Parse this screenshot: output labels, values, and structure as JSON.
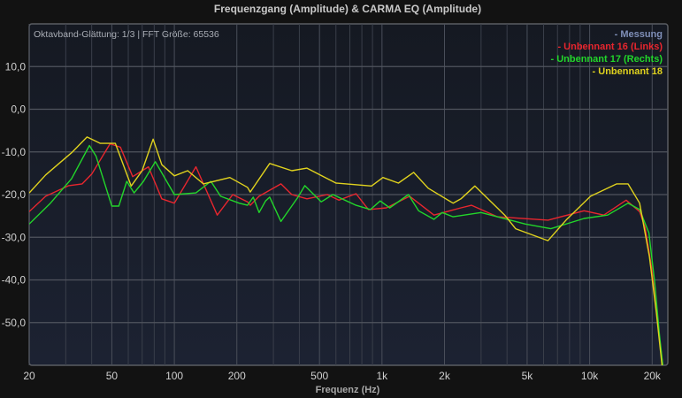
{
  "chart_data": {
    "type": "line",
    "title": "Frequenzgang (Amplitude) & CARMA EQ (Amplitude)",
    "xlabel": "Frequenz (Hz)",
    "ylabel": "",
    "xscale": "log",
    "xlim": [
      20,
      23800
    ],
    "ylim": [
      -60,
      20
    ],
    "grid": true,
    "legend_position": "top-right",
    "annotation": "Oktavband-Glättung: 1/3 | FFT Größe: 65536",
    "x_ticks": [
      {
        "value": 20,
        "label": "20"
      },
      {
        "value": 50,
        "label": "50"
      },
      {
        "value": 100,
        "label": "100"
      },
      {
        "value": 200,
        "label": "200"
      },
      {
        "value": 500,
        "label": "500"
      },
      {
        "value": 1000,
        "label": "1k"
      },
      {
        "value": 2000,
        "label": "2k"
      },
      {
        "value": 5000,
        "label": "5k"
      },
      {
        "value": 10000,
        "label": "10k"
      },
      {
        "value": 20000,
        "label": "20k"
      }
    ],
    "y_ticks": [
      {
        "value": 10,
        "label": "10,0"
      },
      {
        "value": 0,
        "label": "0,0"
      },
      {
        "value": -10,
        "label": "-10,0"
      },
      {
        "value": -20,
        "label": "-20,0"
      },
      {
        "value": -30,
        "label": "-30,0"
      },
      {
        "value": -40,
        "label": "-40,0"
      },
      {
        "value": -50,
        "label": "-50,0"
      }
    ],
    "minor_grid_x": [
      30,
      40,
      60,
      70,
      80,
      90,
      300,
      400,
      600,
      700,
      800,
      900,
      3000,
      4000,
      6000,
      7000,
      8000,
      9000
    ],
    "series": [
      {
        "name": "- Messung",
        "color": "#7f8fb8",
        "points": []
      },
      {
        "name": "- Unbennant 16 (Links)",
        "color": "#e8262e",
        "points": [
          [
            20,
            -24
          ],
          [
            24,
            -20.4
          ],
          [
            31,
            -17.9
          ],
          [
            36,
            -17.5
          ],
          [
            40,
            -15.2
          ],
          [
            49,
            -8.1
          ],
          [
            55,
            -8.9
          ],
          [
            63,
            -15.8
          ],
          [
            75,
            -13.5
          ],
          [
            87,
            -21
          ],
          [
            100,
            -22
          ],
          [
            127,
            -13.5
          ],
          [
            161,
            -24.8
          ],
          [
            191,
            -20
          ],
          [
            225,
            -21.7
          ],
          [
            232,
            -22.5
          ],
          [
            256,
            -20.4
          ],
          [
            326,
            -17.5
          ],
          [
            368,
            -20
          ],
          [
            435,
            -21
          ],
          [
            545,
            -20
          ],
          [
            620,
            -21.3
          ],
          [
            750,
            -19.8
          ],
          [
            860,
            -23.5
          ],
          [
            1050,
            -23.1
          ],
          [
            1360,
            -20.4
          ],
          [
            1780,
            -24.8
          ],
          [
            2400,
            -23.1
          ],
          [
            2700,
            -22.5
          ],
          [
            3600,
            -25.2
          ],
          [
            6300,
            -26
          ],
          [
            9400,
            -23.8
          ],
          [
            11700,
            -24.8
          ],
          [
            15000,
            -21.3
          ],
          [
            17400,
            -24
          ],
          [
            18500,
            -27.7
          ],
          [
            20000,
            -38
          ],
          [
            21500,
            -52
          ],
          [
            22500,
            -60
          ]
        ]
      },
      {
        "name": "- Unbennant 17 (Rechts)",
        "color": "#22d62a",
        "points": [
          [
            20,
            -26.9
          ],
          [
            25.3,
            -22
          ],
          [
            32,
            -16.3
          ],
          [
            39,
            -8.5
          ],
          [
            42,
            -11
          ],
          [
            50,
            -22.7
          ],
          [
            54,
            -22.7
          ],
          [
            59,
            -16.9
          ],
          [
            64,
            -19.6
          ],
          [
            71,
            -16.9
          ],
          [
            81,
            -12.3
          ],
          [
            100,
            -20
          ],
          [
            127,
            -19.6
          ],
          [
            150,
            -16.9
          ],
          [
            167,
            -20.4
          ],
          [
            205,
            -22
          ],
          [
            225,
            -22.5
          ],
          [
            240,
            -20.6
          ],
          [
            256,
            -24.2
          ],
          [
            275,
            -21.5
          ],
          [
            288,
            -20.6
          ],
          [
            326,
            -26.3
          ],
          [
            394,
            -20.6
          ],
          [
            425,
            -17.9
          ],
          [
            510,
            -21.7
          ],
          [
            580,
            -20
          ],
          [
            750,
            -22.5
          ],
          [
            880,
            -23.5
          ],
          [
            980,
            -21.5
          ],
          [
            1090,
            -23.1
          ],
          [
            1340,
            -20
          ],
          [
            1500,
            -23.8
          ],
          [
            1780,
            -25.8
          ],
          [
            1950,
            -24.2
          ],
          [
            2200,
            -25.2
          ],
          [
            3000,
            -24.2
          ],
          [
            4900,
            -26.9
          ],
          [
            6500,
            -28
          ],
          [
            9400,
            -25.6
          ],
          [
            12200,
            -24.8
          ],
          [
            15300,
            -22
          ],
          [
            17400,
            -23.5
          ],
          [
            19300,
            -29
          ],
          [
            20500,
            -40
          ],
          [
            21700,
            -53
          ],
          [
            22500,
            -60
          ]
        ]
      },
      {
        "name": "- Unbennant 18",
        "color": "#e0d21e",
        "points": [
          [
            20,
            -19.6
          ],
          [
            24,
            -15.4
          ],
          [
            32,
            -10.2
          ],
          [
            38,
            -6.5
          ],
          [
            44,
            -8
          ],
          [
            52,
            -8
          ],
          [
            62,
            -18
          ],
          [
            70,
            -14.4
          ],
          [
            79,
            -7
          ],
          [
            87,
            -13
          ],
          [
            100,
            -15.6
          ],
          [
            116,
            -14.4
          ],
          [
            138,
            -17.5
          ],
          [
            185,
            -16
          ],
          [
            225,
            -18.3
          ],
          [
            232,
            -19.4
          ],
          [
            288,
            -12.7
          ],
          [
            368,
            -14.4
          ],
          [
            435,
            -13.8
          ],
          [
            600,
            -17.3
          ],
          [
            890,
            -18
          ],
          [
            1010,
            -16
          ],
          [
            1200,
            -17.3
          ],
          [
            1420,
            -14.8
          ],
          [
            1670,
            -18.5
          ],
          [
            2200,
            -22
          ],
          [
            2400,
            -21
          ],
          [
            2800,
            -18
          ],
          [
            3900,
            -24.8
          ],
          [
            4400,
            -28
          ],
          [
            6300,
            -30.8
          ],
          [
            7700,
            -26
          ],
          [
            10100,
            -20.4
          ],
          [
            13500,
            -17.5
          ],
          [
            15300,
            -17.5
          ],
          [
            17400,
            -22
          ],
          [
            19400,
            -34.6
          ],
          [
            21000,
            -48
          ],
          [
            22300,
            -60
          ]
        ]
      }
    ]
  }
}
